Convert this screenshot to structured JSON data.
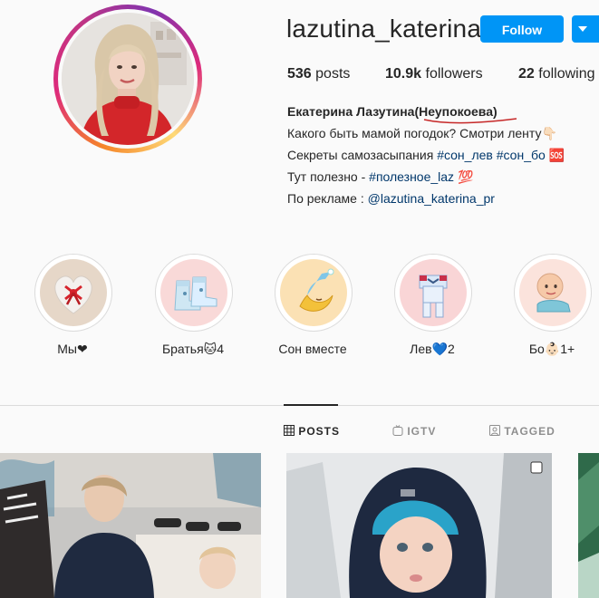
{
  "profile": {
    "username": "lazutina_katerina",
    "follow_label": "Follow",
    "stats": {
      "posts_count": "536",
      "posts_label": "posts",
      "followers_count": "10.9k",
      "followers_label": "followers",
      "following_count": "22",
      "following_label": "following"
    },
    "full_name": "Екатерина Лазутина(Неупокоева)",
    "bio_line1": "Какого быть мамой погодок? Смотри ленту👇🏻",
    "bio_line2_text": "Секреты самозасыпания ",
    "bio_line2_tag1": "#сон_лев",
    "bio_line2_tag2": "#сон_бо",
    "bio_line2_emoji": "🆘",
    "bio_line3_text": "Тут полезно - ",
    "bio_line3_tag": "#полезное_laz",
    "bio_line3_emoji": "💯",
    "bio_line4_text": "По рекламе : ",
    "bio_line4_mention": "@lazutina_katerina_pr"
  },
  "highlights": [
    {
      "label": "Мы❤",
      "icon": "heart-gift-icon"
    },
    {
      "label": "Братья🐱4",
      "icon": "baby-booties-icon"
    },
    {
      "label": "Сон вместе",
      "icon": "sleeping-moon-icon"
    },
    {
      "label": "Лев💙2",
      "icon": "baby-overalls-icon"
    },
    {
      "label": "Бо👶🏻1+",
      "icon": "baby-crawling-icon"
    }
  ],
  "tabs": [
    {
      "label": "POSTS",
      "icon": "grid-icon",
      "active": true
    },
    {
      "label": "IGTV",
      "icon": "igtv-icon",
      "active": false
    },
    {
      "label": "TAGGED",
      "icon": "tagged-icon",
      "active": false
    }
  ],
  "colors": {
    "accent": "#0095f6",
    "text": "#262626",
    "muted": "#8e8e8e",
    "link": "#00376b",
    "background": "#fafafa"
  }
}
